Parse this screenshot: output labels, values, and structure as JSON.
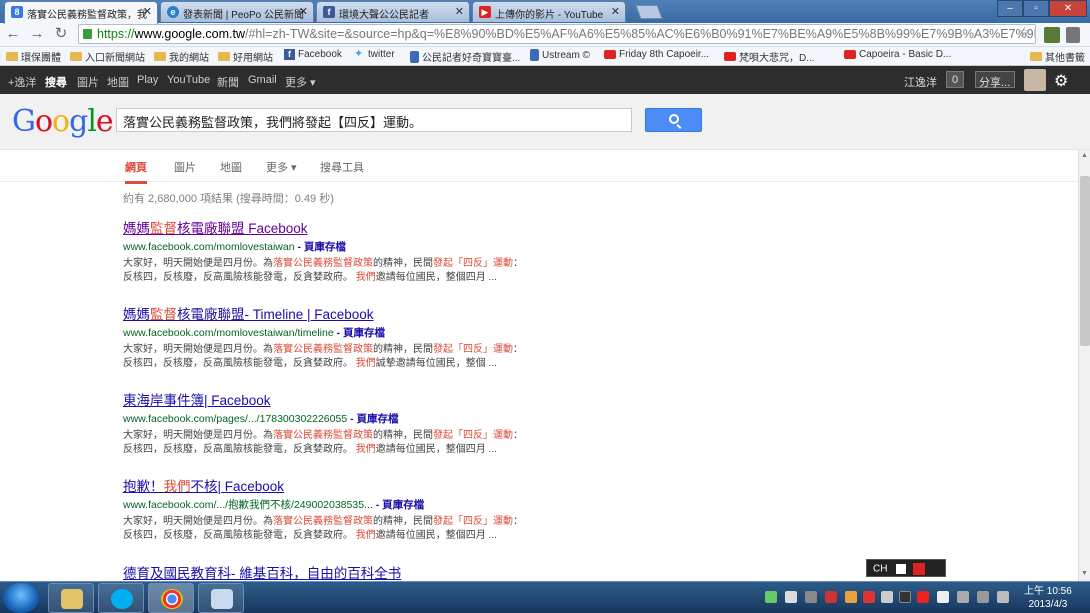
{
  "browser": {
    "tabs": [
      {
        "title": "落實公民義務監督政策，我",
        "icon": "google-favicon",
        "color": "#3b78e7"
      },
      {
        "title": "發表新聞 | PeoPo 公民新聞",
        "icon": "peopo-favicon",
        "color": "#2a7fc9"
      },
      {
        "title": "環境大聲公公民記者",
        "icon": "facebook-favicon",
        "color": "#3b5998"
      },
      {
        "title": "上傳你的影片 - YouTube",
        "icon": "youtube-favicon",
        "color": "#dd2222"
      }
    ],
    "url_https": "https://",
    "url_host": "www.google.com.tw",
    "url_rest": "/#hl=zh-TW&site=&source=hp&q=%E8%90%BD%E5%AF%A6%E5%85%AC%E6%B0%91%E7%BE%A9%E5%8B%99%E7%9B%A3%E7%9D"
  },
  "bookmarks": [
    "環保團體",
    "入口新聞網站",
    "我的網站",
    "好用網站",
    "Facebook",
    "twitter",
    "公民記者好奇寶寶臺...",
    "Ustream ©",
    "Friday 8th Capoeir...",
    "梵唄大悲咒，D...",
    "Capoeira - Basic D...",
    "其他書籤"
  ],
  "google_bar": {
    "links": [
      "+逸洋",
      "搜尋",
      "圖片",
      "地圖",
      "Play",
      "YouTube",
      "新聞",
      "Gmail",
      "更多 ▾"
    ],
    "user": "江逸洋",
    "count": "0",
    "share": "分享..."
  },
  "search": {
    "logo": [
      "G",
      "o",
      "o",
      "g",
      "l",
      "e"
    ],
    "logo_colors": [
      "#3369e8",
      "#d50f25",
      "#eeb211",
      "#3369e8",
      "#009925",
      "#d50f25"
    ],
    "query": "落實公民義務監督政策，我們將發起【四反】運動。"
  },
  "nav_tabs": [
    "網頁",
    "圖片",
    "地圖",
    "更多 ▾",
    "搜尋工具"
  ],
  "stats": "約有 2,680,000 項結果 (搜尋時間：0.49 秒)",
  "results": [
    {
      "title": [
        {
          "t": "媽媽"
        },
        {
          "t": "監督",
          "hl": true
        },
        {
          "t": "核電廠聯盟 Facebook"
        }
      ],
      "url": "www.facebook.com/momlovestaiwan",
      "cache": "- 頁庫存檔",
      "snippet": [
        {
          "t": "大家好，明天開始便是四月份。為"
        },
        {
          "t": "落實公民義務監督政策",
          "em": true
        },
        {
          "t": "的精神，民間"
        },
        {
          "t": "發起「四反」運動",
          "em": true
        },
        {
          "t": "：反核四，反核廢，反高風險核能發電，反貪婪政府。 "
        },
        {
          "t": "我們",
          "em": true
        },
        {
          "t": "邀請每位國民，整個四月 ..."
        }
      ]
    },
    {
      "title": [
        {
          "t": "媽媽"
        },
        {
          "t": "監督",
          "hl": true
        },
        {
          "t": "核電廠聯盟- Timeline | Facebook"
        }
      ],
      "url": "www.facebook.com/momlovestaiwan/timeline",
      "cache": "- 頁庫存檔",
      "snippet": [
        {
          "t": "大家好，明天開始便是四月份。為"
        },
        {
          "t": "落實公民義務監督政策",
          "em": true
        },
        {
          "t": "的精神，民間"
        },
        {
          "t": "發起「四反」運動",
          "em": true
        },
        {
          "t": "：反核四，反核廢，反高風險核能發電，反貪婪政府。 "
        },
        {
          "t": "我們",
          "em": true
        },
        {
          "t": "誠摯邀請每位國民，整個 ..."
        }
      ]
    },
    {
      "title": [
        {
          "t": "東海岸事件簿| Facebook"
        }
      ],
      "url": "www.facebook.com/pages/.../178300302226055",
      "cache": "- 頁庫存檔",
      "snippet": [
        {
          "t": "大家好，明天開始便是四月份。為"
        },
        {
          "t": "落實公民義務監督政策",
          "em": true
        },
        {
          "t": "的精神，民間"
        },
        {
          "t": "發起「四反」運動",
          "em": true
        },
        {
          "t": "：反核四，反核廢，反高風險核能發電，反貪婪政府。 "
        },
        {
          "t": "我們",
          "em": true
        },
        {
          "t": "邀請每位國民，整個四月 ..."
        }
      ]
    },
    {
      "title": [
        {
          "t": "抱歉！"
        },
        {
          "t": "我們",
          "hl": true
        },
        {
          "t": "不核| Facebook"
        }
      ],
      "url": "www.facebook.com/.../抱歉我們不核/249002038535...",
      "cache": "- 頁庫存檔",
      "snippet": [
        {
          "t": "大家好，明天開始便是四月份。為"
        },
        {
          "t": "落實公民義務監督政策",
          "em": true
        },
        {
          "t": "的精神，民間"
        },
        {
          "t": "發起「四反」運動",
          "em": true
        },
        {
          "t": "：反核四，反核廢，反高風險核能發電，反貪婪政府。 "
        },
        {
          "t": "我們",
          "em": true
        },
        {
          "t": "邀請每位國民，整個四月 ..."
        }
      ]
    },
    {
      "title": [
        {
          "t": "德育及國民教育科- 維基百科，自由的百科全书"
        }
      ],
      "url": "",
      "cache": "",
      "snippet": []
    }
  ],
  "ime": "CH",
  "clock": {
    "time": "上午 10:56",
    "date": "2013/4/3"
  }
}
